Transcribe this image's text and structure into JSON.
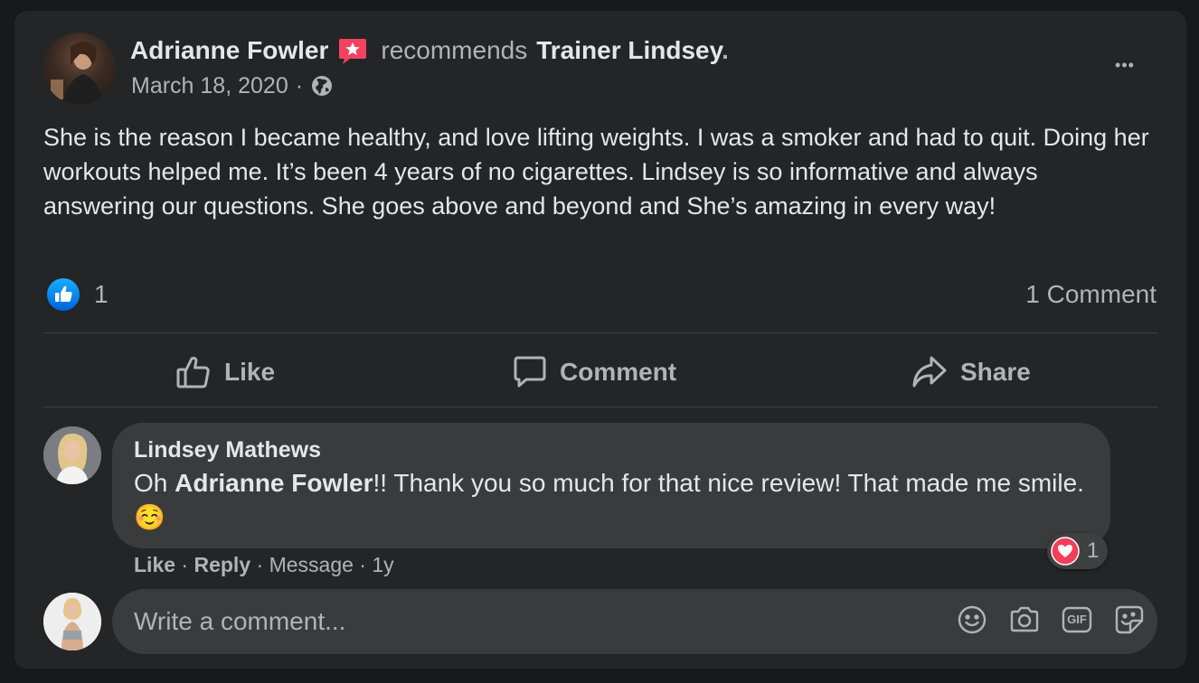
{
  "post": {
    "author": "Adrianne Fowler",
    "verb": "recommends",
    "page_name": "Trainer Lindsey",
    "period": ".",
    "date": "March 18, 2020",
    "dot": "·",
    "more_label": "•••",
    "text": "She is the reason I became healthy, and love lifting weights. I was a smoker and had to quit. Doing her workouts helped me. It’s been 4 years of no cigarettes. Lindsey is so informative and always answering our questions. She goes above and beyond and She’s amazing in every way!",
    "like_count": "1",
    "comment_count": "1 Comment"
  },
  "actions": {
    "like": "Like",
    "comment": "Comment",
    "share": "Share"
  },
  "comment": {
    "author": "Lindsey Mathews",
    "text_prefix": "Oh ",
    "mention": "Adrianne Fowler",
    "text_suffix": "!! Thank you so much for that nice review! That made me smile. ",
    "emoji": "☺️",
    "reaction_count": "1",
    "meta": {
      "like": "Like",
      "sep": " · ",
      "reply": "Reply",
      "message": "Message",
      "age": "1y"
    }
  },
  "composer": {
    "placeholder": "Write a comment...",
    "gif_label": "GIF"
  },
  "colors": {
    "card": "#242526",
    "bubble": "#3a3b3c",
    "like_blue": "#2d88ff",
    "heart_red": "#f33e58",
    "recommend_red": "#f3425f"
  }
}
